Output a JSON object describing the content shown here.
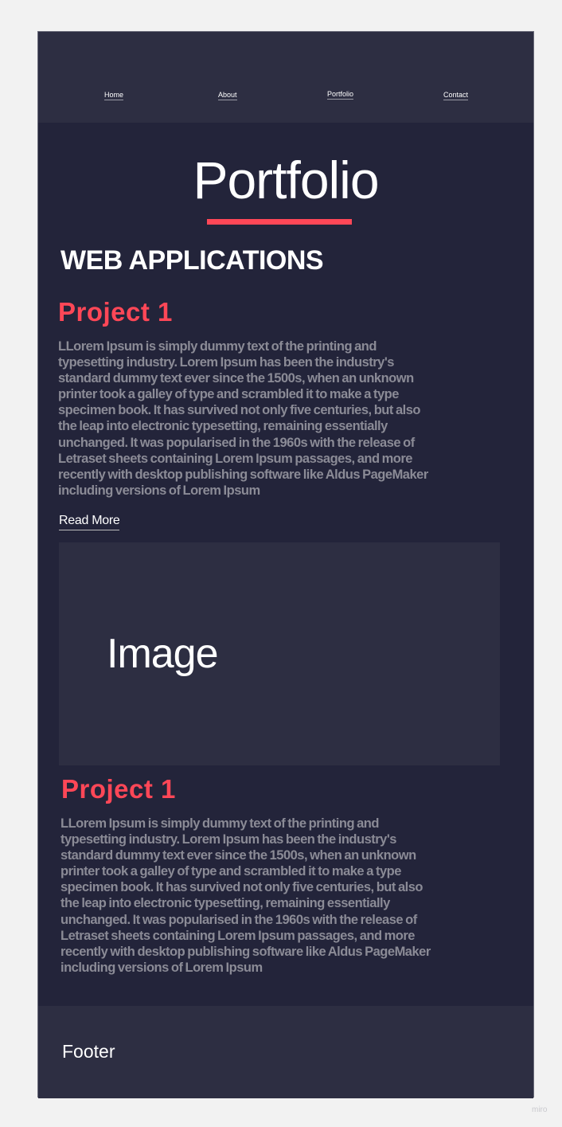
{
  "nav": [
    "Home",
    "About",
    "Portfolio",
    "Contact"
  ],
  "page_title": "Portfolio",
  "section_title": "WEB APPLICATIONS",
  "projects": [
    {
      "title": "Project 1",
      "lines": [
        "LLorem Ipsum is simply dummy text of the printing and",
        "typesetting industry. Lorem Ipsum has been the industry's",
        "standard dummy  text ever since the 1500s, when an unknown",
        "printer took a galley of  type and scrambled it to make a type",
        "specimen book. It has survived not  only five centuries, but also",
        "the leap into electronic typesetting,  remaining essentially",
        "unchanged. It was popularised in the 1960s with  the release of",
        "Letraset sheets containing Lorem Ipsum passages, and more",
        "recently with desktop publishing software like Aldus PageMaker",
        " including versions of Lorem Ipsum"
      ],
      "read_more": "Read More"
    },
    {
      "title": "Project 1",
      "lines": [
        "LLorem Ipsum is simply dummy text of the printing and",
        "typesetting industry. Lorem Ipsum has been the industry's",
        "standard dummy  text ever since the 1500s, when an unknown",
        "printer took a galley of  type and scrambled it to make a type",
        "specimen book. It has survived not  only five centuries, but also",
        "the leap into electronic typesetting,  remaining essentially",
        "unchanged. It was popularised in the 1960s with  the release of",
        "Letraset sheets containing Lorem Ipsum passages, and more",
        "recently with desktop publishing software like Aldus PageMaker",
        " including versions of Lorem Ipsum"
      ]
    }
  ],
  "image_placeholder": "Image",
  "footer": "Footer",
  "watermark": "miro",
  "colors": {
    "header": "#2d2e42",
    "body": "#23243a",
    "accent": "#ff4757",
    "text_muted": "#8b8b96"
  }
}
